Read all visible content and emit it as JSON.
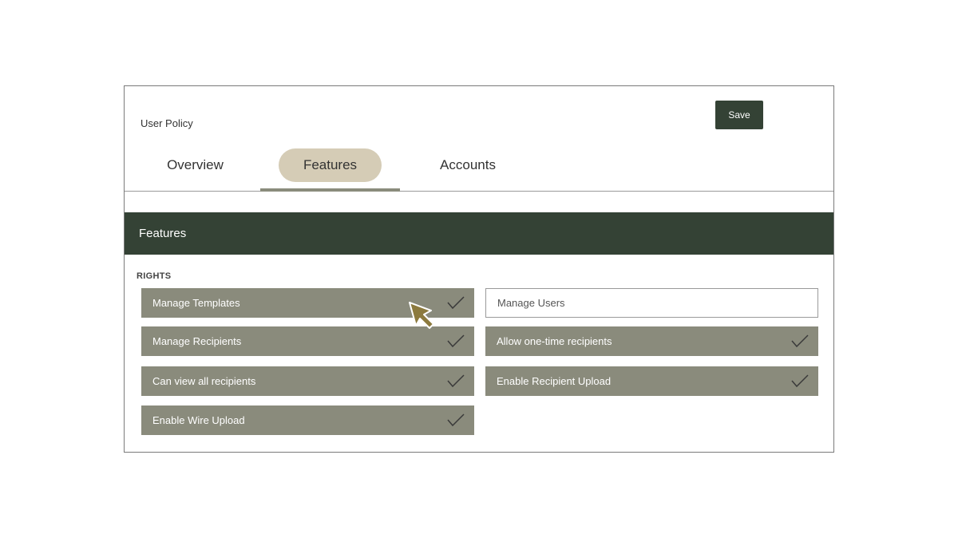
{
  "header": {
    "title": "User Policy",
    "save_label": "Save"
  },
  "tabs": [
    {
      "label": "Overview",
      "active": false
    },
    {
      "label": "Features",
      "active": true
    },
    {
      "label": "Accounts",
      "active": false
    }
  ],
  "section": {
    "title": "Features",
    "rights_label": "RIGHTS"
  },
  "rights": [
    {
      "label": "Manage Templates",
      "checked": true
    },
    {
      "label": "Manage Users",
      "checked": false
    },
    {
      "label": "Manage Recipients",
      "checked": true
    },
    {
      "label": "Allow one-time recipients",
      "checked": true
    },
    {
      "label": "Can view all recipients",
      "checked": true
    },
    {
      "label": "Enable Recipient Upload",
      "checked": true
    },
    {
      "label": "Enable Wire Upload",
      "checked": true
    }
  ],
  "colors": {
    "primary_dark": "#344235",
    "active_tab": "#d5ccb6",
    "checked_item": "#8a8b7c",
    "cursor": "#8c7a3e"
  },
  "icons": {
    "check": "check-icon",
    "pointer": "cursor-arrow-icon"
  }
}
